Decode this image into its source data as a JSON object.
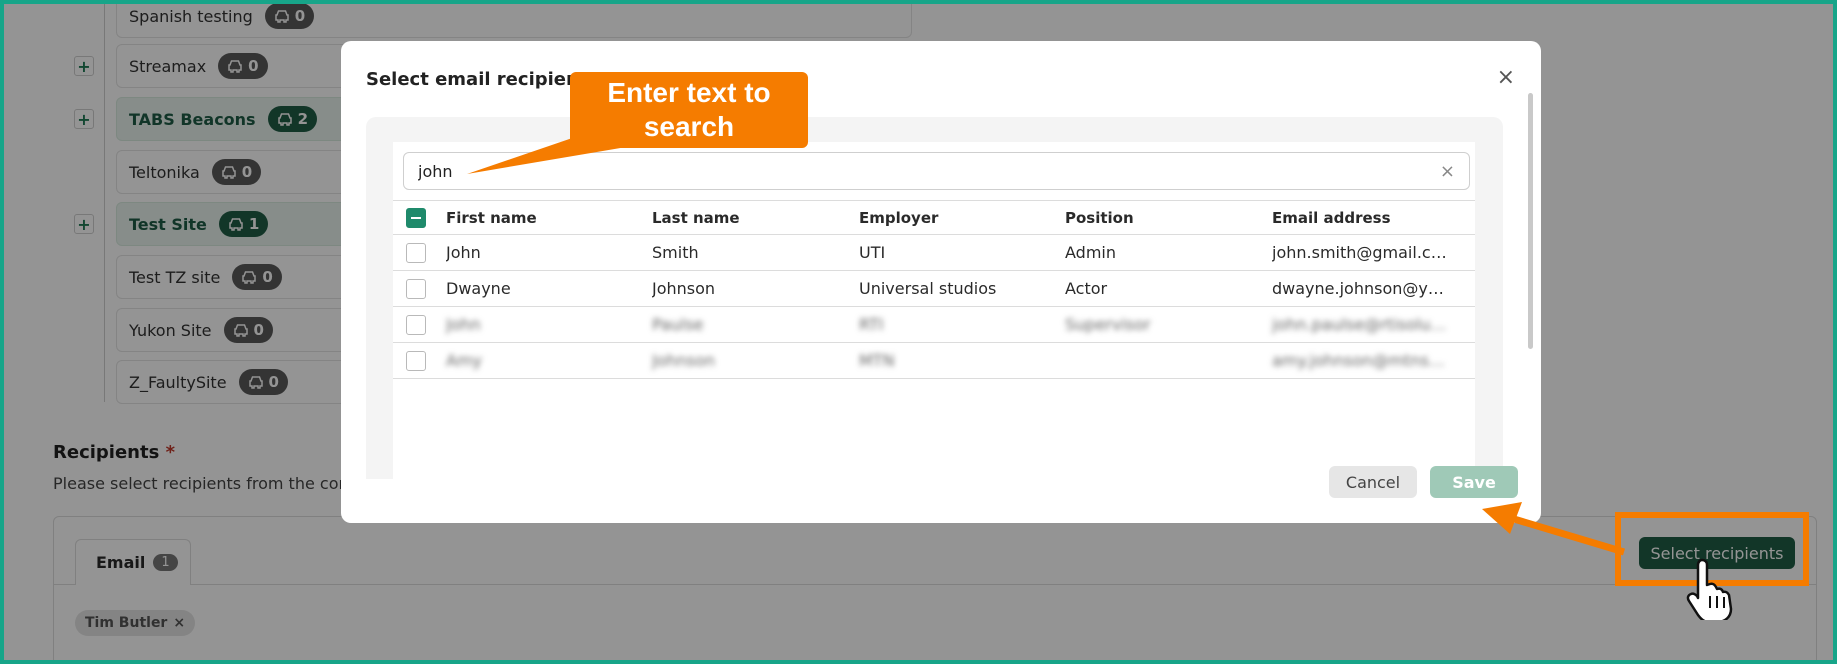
{
  "background": {
    "sites": [
      {
        "name": "Spanish testing",
        "vehicles": "0",
        "highlighted": false,
        "has_expand": false
      },
      {
        "name": "Streamax",
        "vehicles": "0",
        "highlighted": false,
        "has_expand": true
      },
      {
        "name": "TABS Beacons",
        "vehicles": "2",
        "highlighted": true,
        "has_expand": true
      },
      {
        "name": "Teltonika",
        "vehicles": "0",
        "highlighted": false,
        "has_expand": false
      },
      {
        "name": "Test Site",
        "vehicles": "1",
        "highlighted": true,
        "has_expand": true
      },
      {
        "name": "Test TZ site",
        "vehicles": "0",
        "highlighted": false,
        "has_expand": false
      },
      {
        "name": "Yukon Site",
        "vehicles": "0",
        "highlighted": false,
        "has_expand": false
      },
      {
        "name": "Z_FaultySite",
        "vehicles": "0",
        "highlighted": false,
        "has_expand": false
      }
    ],
    "expand_symbol": "+",
    "recipients": {
      "title": "Recipients",
      "required_mark": "*",
      "help_text": "Please select recipients from the cont",
      "tab_label": "Email",
      "tab_count": "1",
      "chips": [
        {
          "label": "Tim Butler",
          "remove": "×"
        }
      ],
      "select_button": "Select recipients"
    }
  },
  "modal": {
    "title": "Select email recipients",
    "close": "×",
    "search": {
      "value": "john",
      "clear": "×"
    },
    "columns": [
      "First name",
      "Last name",
      "Employer",
      "Position",
      "Email address"
    ],
    "rows": [
      {
        "first": "John",
        "last": "Smith",
        "employer": "UTI",
        "position": "Admin",
        "email": "john.smith@gmail.com",
        "blurred": false
      },
      {
        "first": "Dwayne",
        "last": "Johnson",
        "employer": "Universal studios",
        "position": "Actor",
        "email": "dwayne.johnson@yah...",
        "blurred": false
      },
      {
        "first": "John",
        "last": "Paulse",
        "employer": "RTI",
        "position": "Supervisor",
        "email": "john.paulse@rtisoluti...",
        "blurred": true
      },
      {
        "first": "Amy",
        "last": "Johnson",
        "employer": "MTN",
        "position": "",
        "email": "amy.johnson@mtnsa...",
        "blurred": true
      }
    ],
    "cancel": "Cancel",
    "save": "Save"
  },
  "annotation": {
    "callout_text": "Enter text to search",
    "accent": "#f57c00"
  },
  "colors": {
    "brand_green": "#1f5d45",
    "frame": "#17a589"
  }
}
